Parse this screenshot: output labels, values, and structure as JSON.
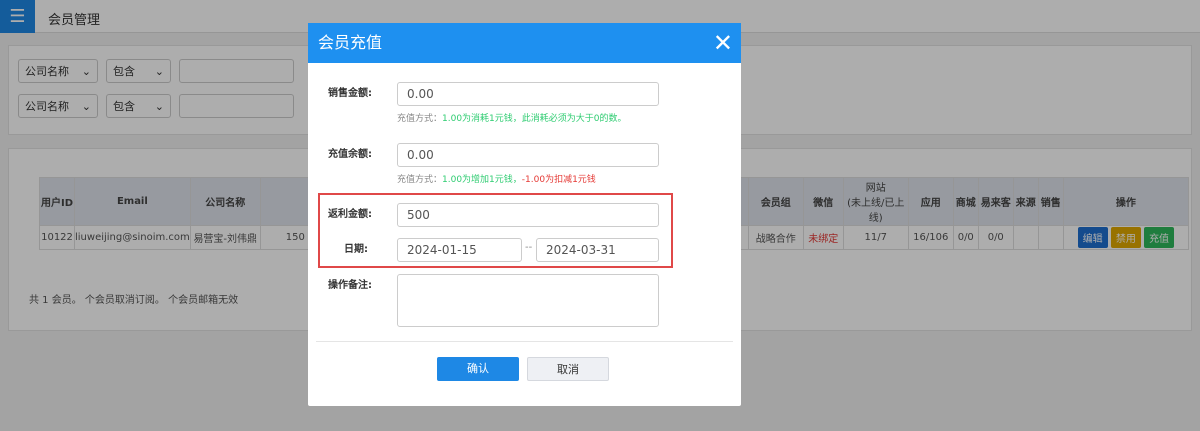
{
  "header": {
    "menu_icon": "menu-icon",
    "title": "会员管理"
  },
  "filters": [
    {
      "field": "公司名称",
      "op": "包含",
      "value": ""
    },
    {
      "field": "公司名称",
      "op": "包含",
      "value": ""
    }
  ],
  "table": {
    "headers": [
      "用户ID",
      "Email",
      "公司名称",
      "",
      "会员组",
      "微信",
      "网站",
      "(未上线/已上线)",
      "应用",
      "商城",
      "易来客",
      "来源",
      "销售",
      "操作"
    ],
    "row": {
      "id": "10122",
      "email": "liuweijing@sinoim.com",
      "company": "易营宝-刘伟鼎",
      "partial": "150",
      "group": "战略合作",
      "wechat": "未绑定",
      "site": "11/7",
      "app": "16/106",
      "mall": "0/0",
      "ylk": "0/0",
      "source": "",
      "sales": ""
    },
    "actions": [
      "编辑",
      "禁用",
      "充值"
    ],
    "summary": "共 1 会员。 个会员取消订阅。 个会员邮箱无效"
  },
  "modal": {
    "title": "会员充值",
    "sales_label": "销售金额:",
    "sales_value": "0.00",
    "sales_hint_prefix": "充值方式：",
    "sales_hint": "1.00为消耗1元钱，此消耗必须为大于0的数。",
    "balance_label": "充值余额:",
    "balance_value": "0.00",
    "balance_hint_prefix": "充值方式：",
    "balance_hint_green": "1.00为增加1元钱，",
    "balance_hint_red": "-1.00为扣减1元钱",
    "rebate_label": "返利金额:",
    "rebate_value": "500",
    "date_label": "日期:",
    "date_from": "2024-01-15",
    "date_sep": "--",
    "date_to": "2024-03-31",
    "note_label": "操作备注:",
    "note_value": "",
    "confirm": "确认",
    "cancel": "取消"
  }
}
